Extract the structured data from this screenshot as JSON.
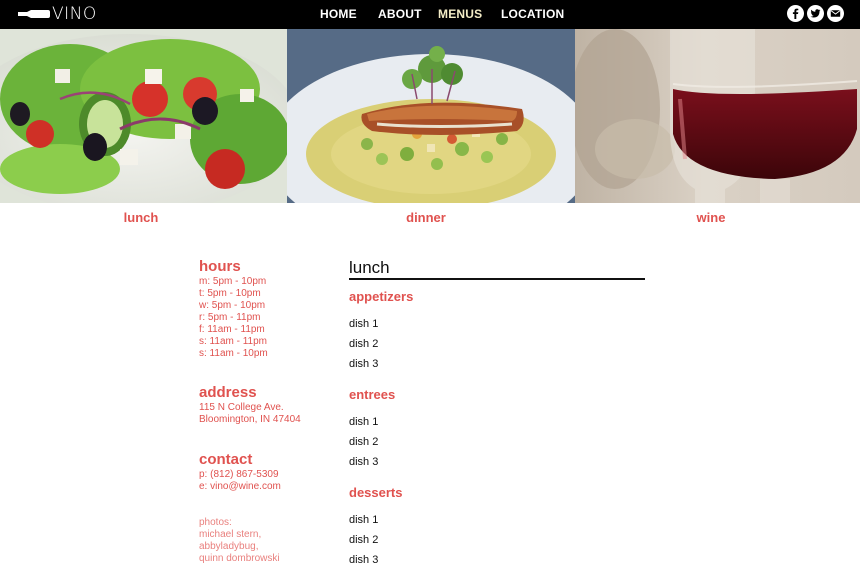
{
  "brand": {
    "name": "VINO"
  },
  "nav": {
    "items": [
      "HOME",
      "ABOUT",
      "MENUS",
      "LOCATION"
    ],
    "active": "MENUS",
    "active_color": "#f3ecc6"
  },
  "social": [
    "facebook-icon",
    "twitter-icon",
    "mail-icon"
  ],
  "categories": [
    "lunch",
    "dinner",
    "wine"
  ],
  "accent_color": "#e0524f",
  "sidebar": {
    "hours": {
      "title": "hours",
      "lines": [
        "m: 5pm - 10pm",
        "t: 5pm - 10pm",
        "w: 5pm - 10pm",
        "r: 5pm - 11pm",
        "f: 11am - 11pm",
        "s: 11am - 11pm",
        "s: 11am - 10pm"
      ]
    },
    "address": {
      "title": "address",
      "lines": [
        "115 N College Ave.",
        "Bloomington, IN 47404"
      ]
    },
    "contact": {
      "title": "contact",
      "lines": [
        "p: (812) 867-5309",
        "e: vino@wine.com"
      ]
    },
    "credits": {
      "lines": [
        "photos:",
        "michael stern,",
        "abbyladybug,",
        "quinn dombrowski"
      ]
    }
  },
  "menu": {
    "title": "lunch",
    "sections": [
      {
        "title": "appetizers",
        "dishes": [
          "dish 1",
          "dish 2",
          "dish 3"
        ]
      },
      {
        "title": "entrees",
        "dishes": [
          "dish 1",
          "dish 2",
          "dish 3"
        ]
      },
      {
        "title": "desserts",
        "dishes": [
          "dish 1",
          "dish 2",
          "dish 3"
        ]
      }
    ]
  }
}
